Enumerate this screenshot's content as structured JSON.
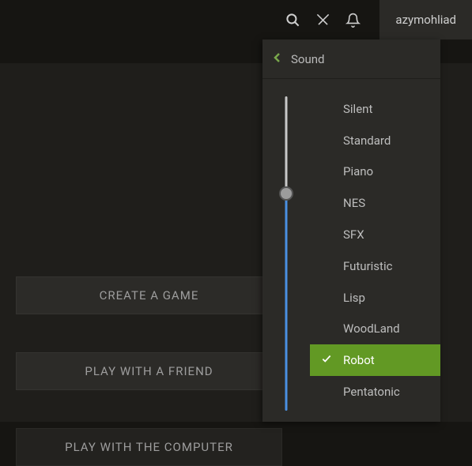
{
  "header": {
    "username": "azymohliad"
  },
  "main": {
    "buttons": [
      "CREATE A GAME",
      "PLAY WITH A FRIEND",
      "PLAY WITH THE COMPUTER"
    ]
  },
  "soundPanel": {
    "title": "Sound",
    "slider": {
      "percentFromTop": 31
    },
    "options": [
      {
        "label": "Silent",
        "selected": false
      },
      {
        "label": "Standard",
        "selected": false
      },
      {
        "label": "Piano",
        "selected": false
      },
      {
        "label": "NES",
        "selected": false
      },
      {
        "label": "SFX",
        "selected": false
      },
      {
        "label": "Futuristic",
        "selected": false
      },
      {
        "label": "Lisp",
        "selected": false
      },
      {
        "label": "WoodLand",
        "selected": false
      },
      {
        "label": "Robot",
        "selected": true
      },
      {
        "label": "Pentatonic",
        "selected": false
      }
    ]
  },
  "colors": {
    "accent": "#629924",
    "sliderFill": "#4a90e2"
  }
}
